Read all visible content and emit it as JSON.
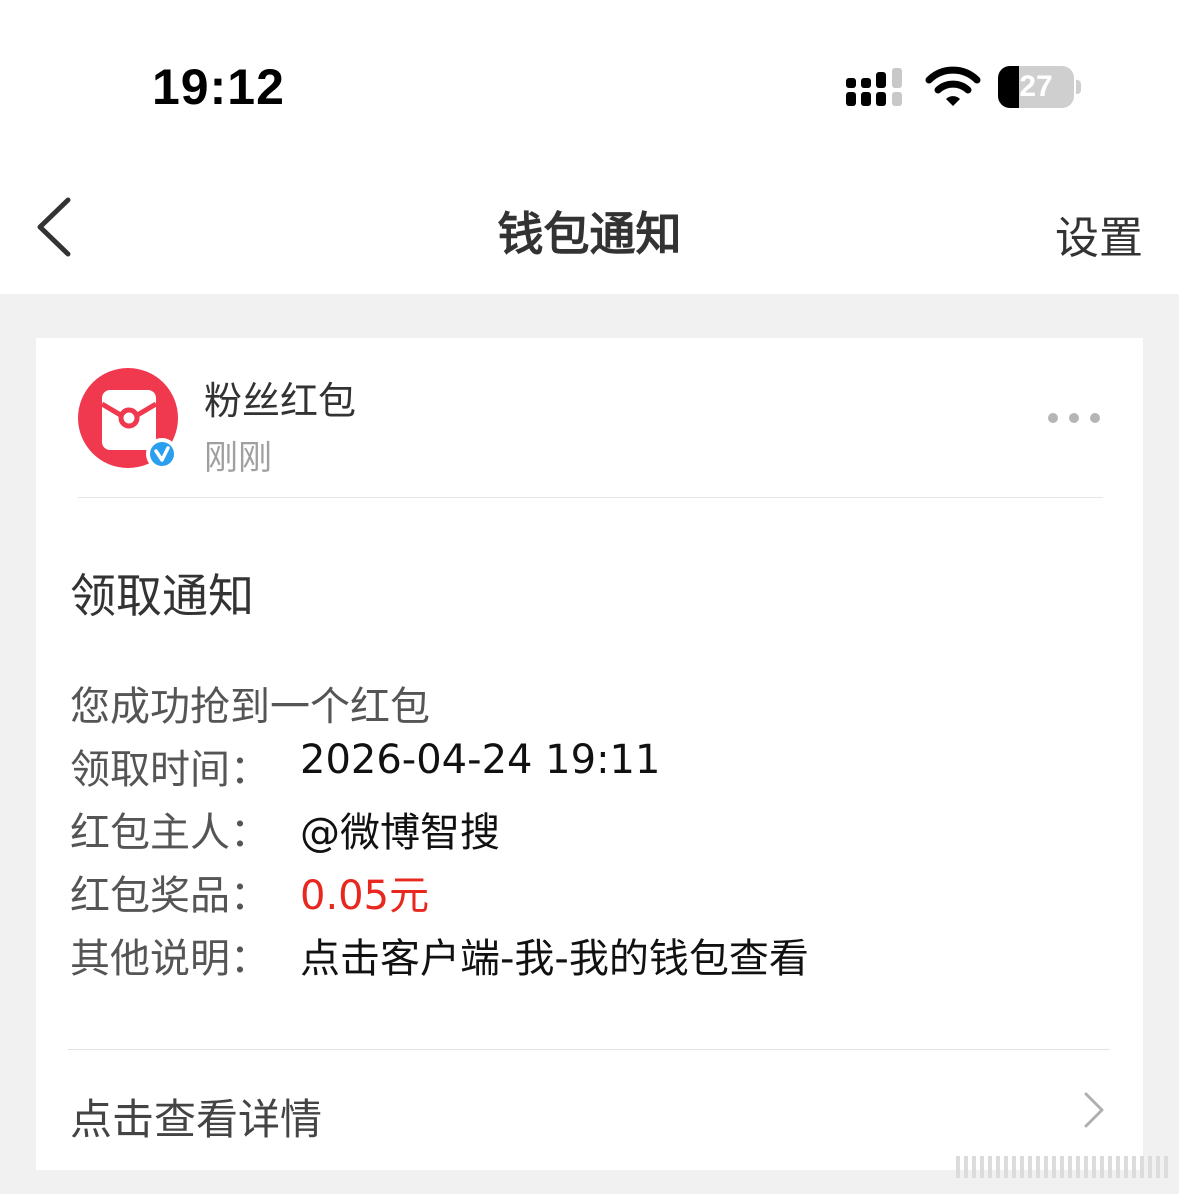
{
  "status_bar": {
    "time": "19:12",
    "battery_level": "27",
    "battery_fraction": 0.27
  },
  "nav": {
    "title": "钱包通知",
    "settings_label": "设置"
  },
  "message": {
    "sender_name": "粉丝红包",
    "sender_time": "刚刚",
    "title": "领取通知",
    "intro": "您成功抢到一个红包",
    "fields": [
      {
        "label": "领取时间：",
        "value": "2026-04-24 19:11"
      },
      {
        "label": "红包主人：",
        "value": "@微博智搜"
      },
      {
        "label": "红包奖品：",
        "value": "0.05元"
      },
      {
        "label": "其他说明：",
        "value": "点击客户端-我-我的钱包查看"
      }
    ],
    "detail_link": "点击查看详情"
  },
  "colors": {
    "accent_red": "#e8281e",
    "verified_blue": "#2a9ff0",
    "avatar_red": "#f0384e"
  },
  "icons": {
    "back": "chevron-left-icon",
    "more": "more-dots-icon",
    "verified": "verified-badge-icon",
    "chevron": "chevron-right-icon"
  }
}
